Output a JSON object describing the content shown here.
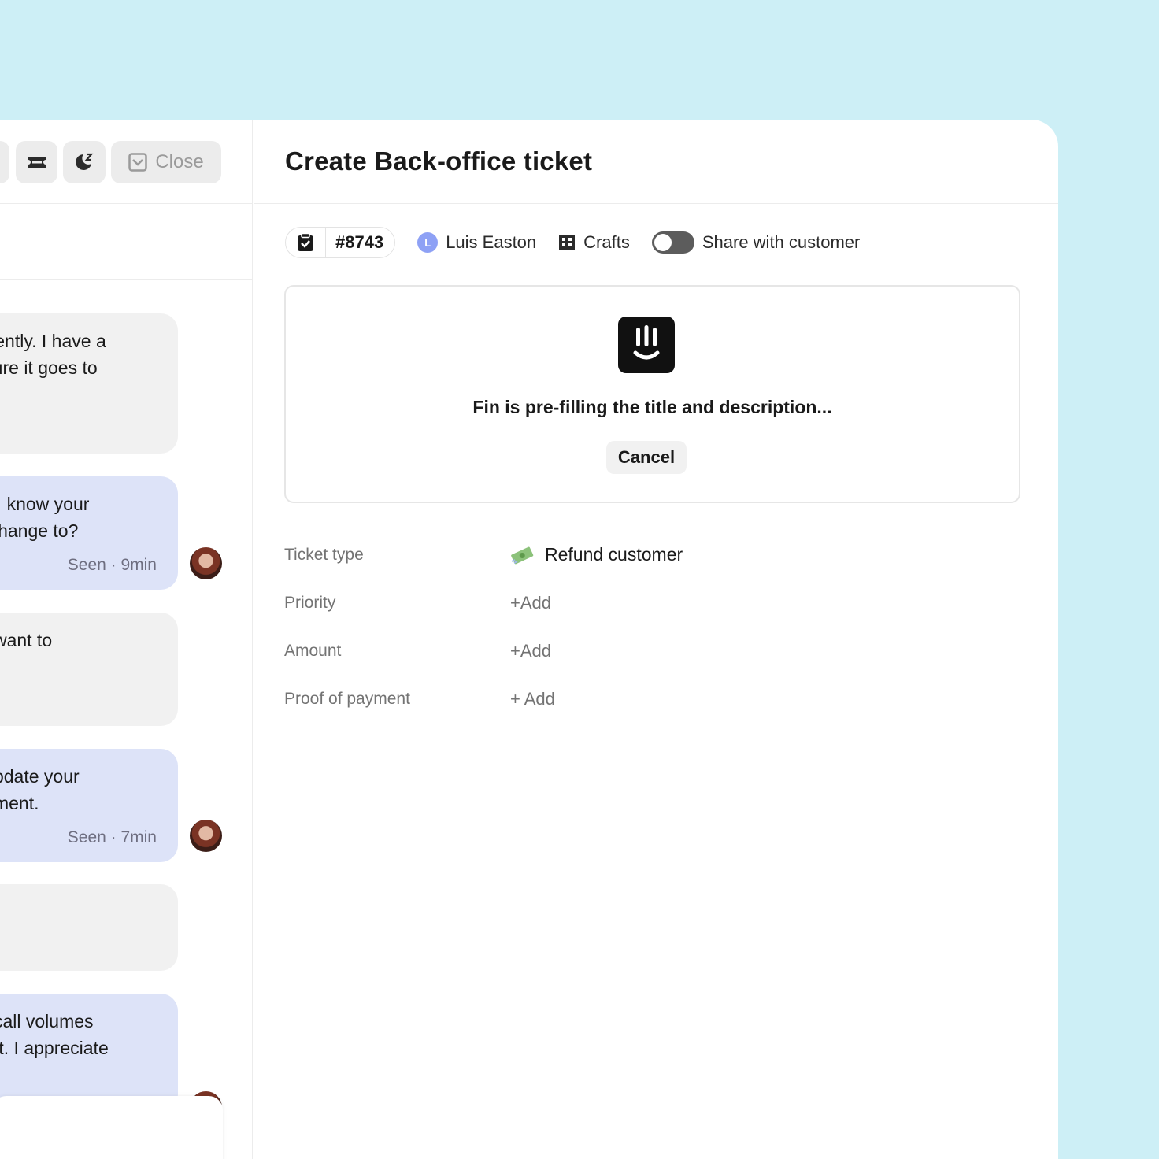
{
  "toolbar": {
    "close_label": "Close"
  },
  "conversation": {
    "messages": [
      {
        "type": "customer",
        "lines": [
          "urgently. I have a",
          "e sure it goes to"
        ]
      },
      {
        "type": "agent",
        "lines": [
          "lay I know your",
          "to change to?"
        ],
        "seen": "Seen · 9min"
      },
      {
        "type": "customer",
        "lines": [
          "d I want to"
        ]
      },
      {
        "type": "agent",
        "lines": [
          "e update your",
          "moment."
        ],
        "seen": "Seen · 7min"
      },
      {
        "type": "customer",
        "lines": []
      },
      {
        "type": "agent",
        "lines": [
          "gh call volumes",
          "ount. I appreciate"
        ]
      }
    ]
  },
  "panel": {
    "title": "Create Back-office ticket",
    "ticket_id": "#8743",
    "assignee_initial": "L",
    "assignee": "Luis Easton",
    "company": "Crafts",
    "share_label": "Share with customer",
    "share_enabled": false
  },
  "fin": {
    "status": "Fin is pre-filling the title and description...",
    "cancel_label": "Cancel"
  },
  "fields": [
    {
      "label": "Ticket type",
      "value": "Refund customer",
      "icon": "money-icon"
    },
    {
      "label": "Priority",
      "value": "+Add"
    },
    {
      "label": "Amount",
      "value": "+Add"
    },
    {
      "label": "Proof of payment",
      "value": "+ Add"
    }
  ],
  "colors": {
    "background": "#cdeff6",
    "agent_bubble": "#dde3f8",
    "customer_bubble": "#f1f1f1",
    "assignee_dot": "#8ea1f5"
  }
}
